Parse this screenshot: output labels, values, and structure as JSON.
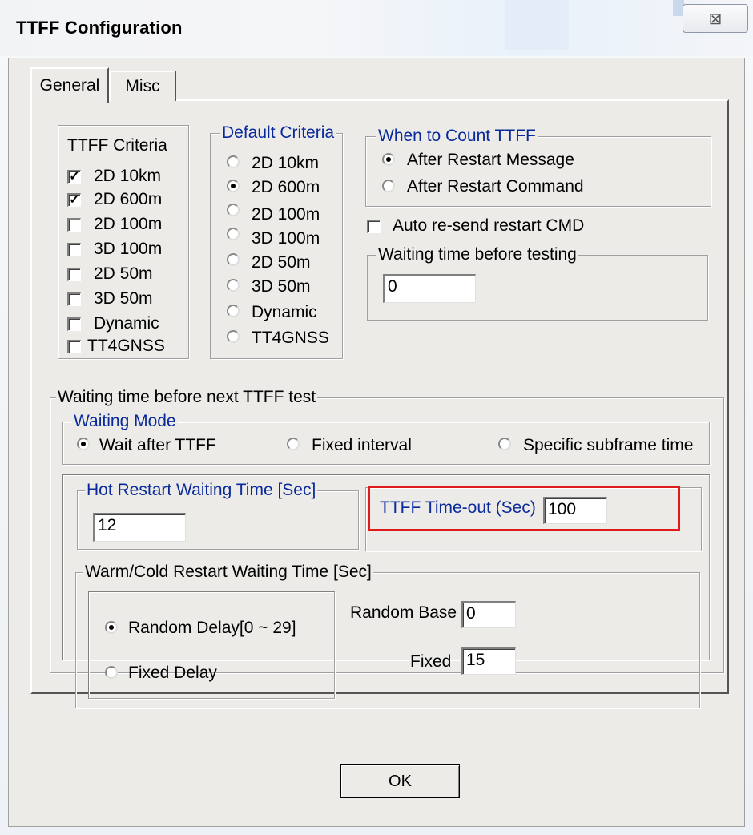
{
  "window": {
    "title": "TTFF Configuration",
    "close_glyph": "⊠",
    "close_icon": "close-icon"
  },
  "tabs": [
    {
      "label": "General",
      "selected": true
    },
    {
      "label": "Misc",
      "selected": false
    }
  ],
  "ttff_criteria": {
    "label": "TTFF Criteria",
    "items": [
      {
        "label": "2D 10km",
        "checked": true
      },
      {
        "label": "2D 600m",
        "checked": true
      },
      {
        "label": "2D 100m",
        "checked": false
      },
      {
        "label": "3D 100m",
        "checked": false
      },
      {
        "label": "2D 50m",
        "checked": false
      },
      {
        "label": "3D 50m",
        "checked": false
      },
      {
        "label": "Dynamic",
        "checked": false
      },
      {
        "label": "TT4GNSS",
        "checked": false
      }
    ]
  },
  "default_criteria": {
    "label": "Default Criteria",
    "items": [
      {
        "label": "2D 10km",
        "selected": false
      },
      {
        "label": "2D 600m",
        "selected": true
      },
      {
        "label": "2D 100m",
        "selected": false
      },
      {
        "label": "3D 100m",
        "selected": false
      },
      {
        "label": "2D 50m",
        "selected": false
      },
      {
        "label": "3D 50m",
        "selected": false
      },
      {
        "label": "Dynamic",
        "selected": false
      },
      {
        "label": "TT4GNSS",
        "selected": false
      }
    ]
  },
  "when_to_count": {
    "label": "When to Count TTFF",
    "options": [
      {
        "label": "After Restart Message",
        "selected": true
      },
      {
        "label": "After Restart Command",
        "selected": false
      }
    ]
  },
  "auto_resend": {
    "label": "Auto re-send restart CMD",
    "checked": false
  },
  "waiting_before_testing": {
    "label": "Waiting time before testing",
    "value": "0"
  },
  "next_test": {
    "label": "Waiting time before next TTFF test",
    "waiting_mode": {
      "label": "Waiting Mode",
      "options": [
        {
          "label": "Wait after TTFF",
          "selected": true
        },
        {
          "label": "Fixed interval",
          "selected": false
        },
        {
          "label": "Specific subframe time",
          "selected": false
        }
      ]
    },
    "hot_restart": {
      "label": "Hot Restart Waiting Time [Sec]",
      "value": "12"
    },
    "ttff_timeout": {
      "label": "TTFF Time-out (Sec)",
      "value": "100",
      "highlight_color": "#e01b1b"
    },
    "warm_cold": {
      "label": "Warm/Cold Restart Waiting Time [Sec]",
      "options": [
        {
          "label": "Random Delay[0 ~ 29]",
          "selected": true
        },
        {
          "label": "Fixed Delay",
          "selected": false
        }
      ],
      "random_base": {
        "label": "Random Base",
        "value": "0"
      },
      "fixed": {
        "label": "Fixed",
        "value": "15"
      }
    }
  },
  "ok_button": {
    "label": "OK"
  },
  "colors": {
    "group_label_blue": "#0a2a9c",
    "face": "#ecebe8"
  }
}
